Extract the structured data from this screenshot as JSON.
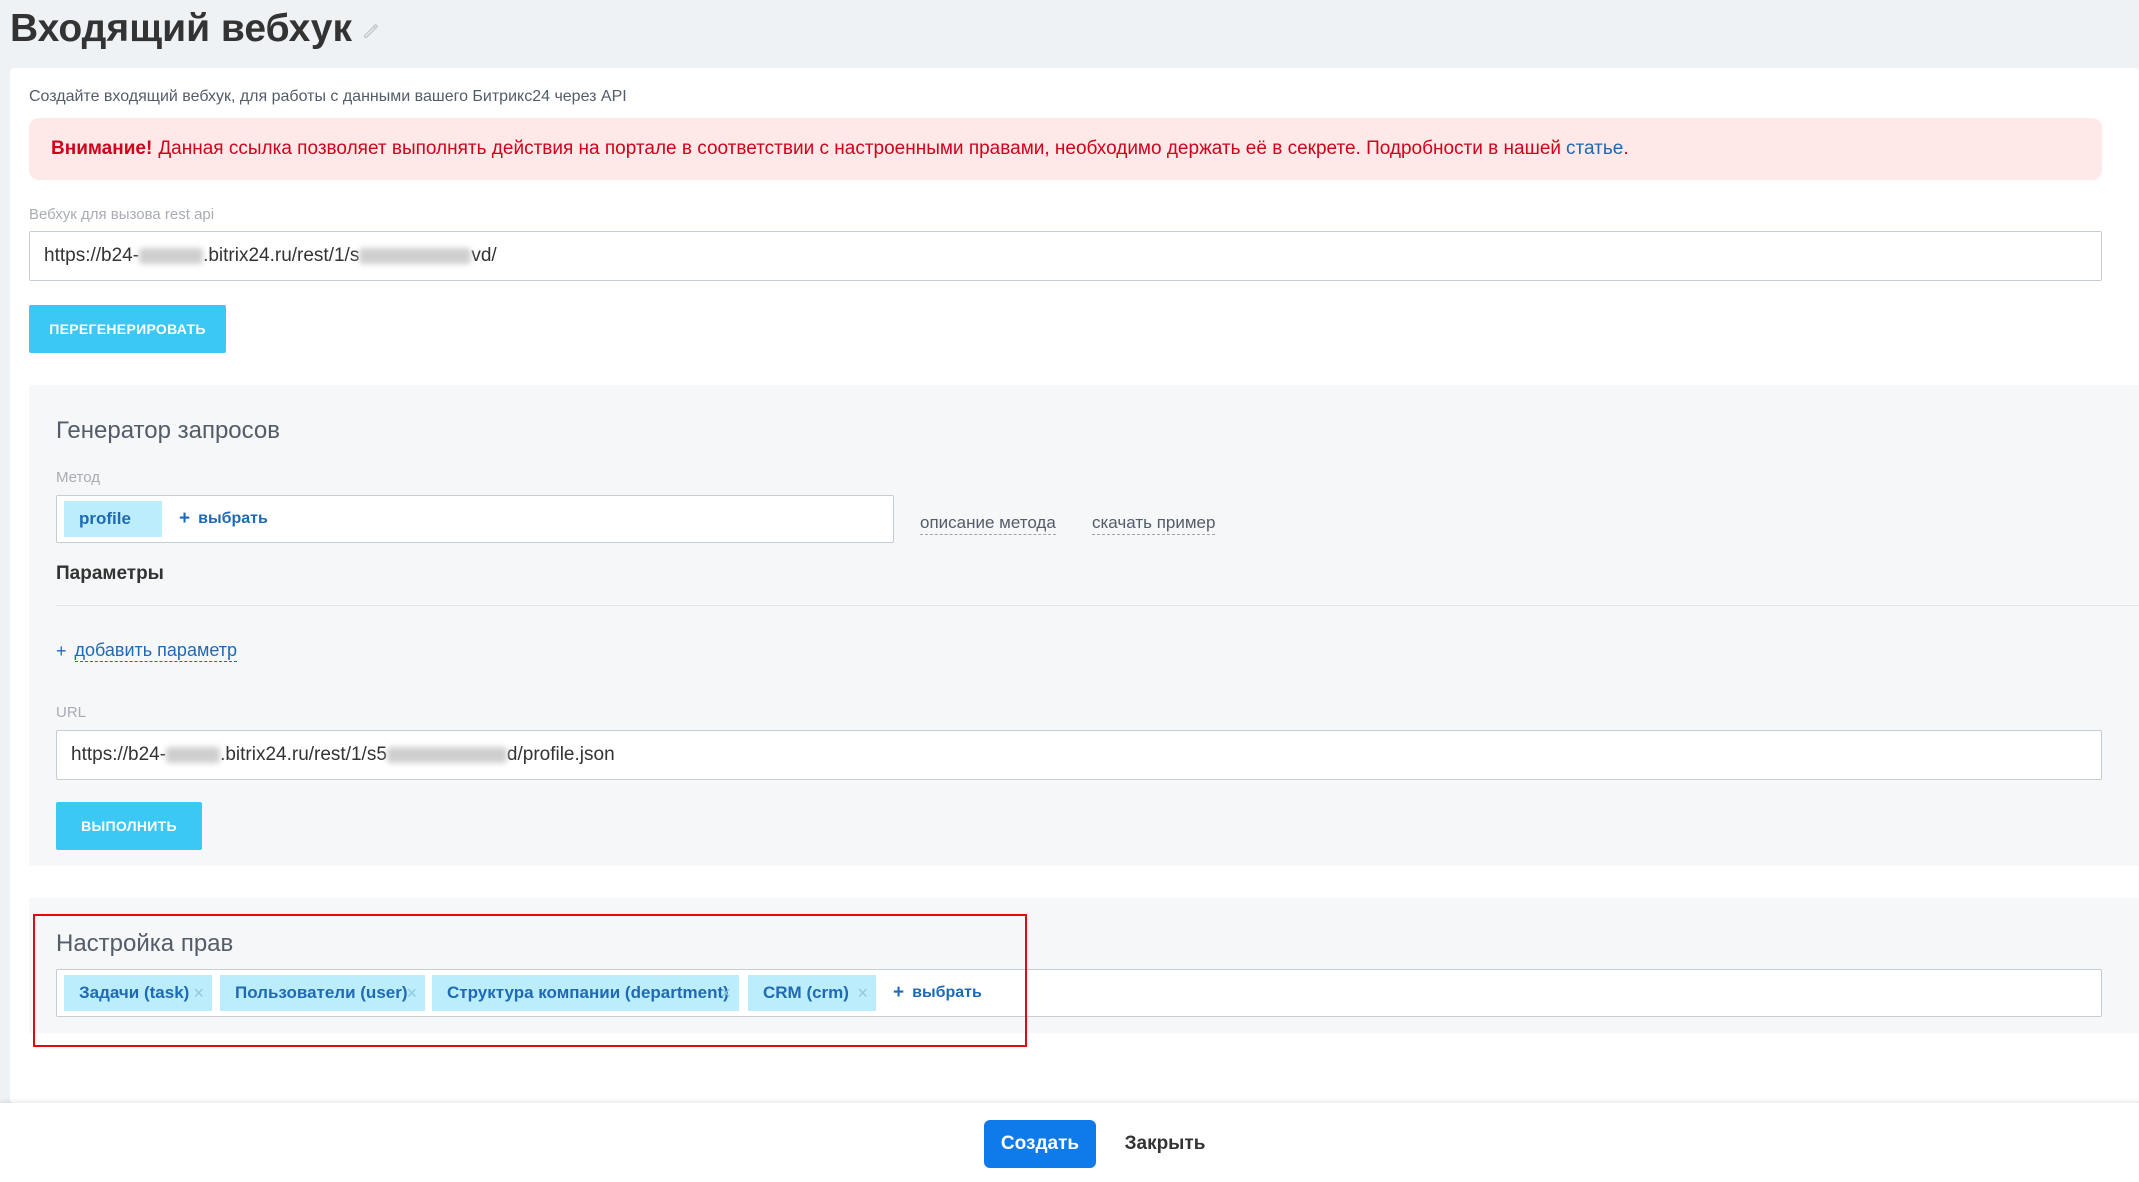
{
  "page": {
    "title": "Входящий вебхук"
  },
  "intro": {
    "subtitle": "Создайте входящий вебхук, для работы с данными вашего Битрикс24 через API"
  },
  "alert": {
    "strong": "Внимание!",
    "text": "Данная ссылка позволяет выполнять действия на портале в соответствии с настроенными правами, необходимо держать её в секрете. Подробности в нашей",
    "link": "статье",
    "trail": "."
  },
  "webhook": {
    "label": "Вебхук для вызова rest api",
    "url_prefix": "https://b24-",
    "url_mid": ".bitrix24.ru/rest/1/s",
    "url_suffix": "vd/",
    "regenerate_label": "ПЕРЕГЕНЕРИРОВАТЬ"
  },
  "generator": {
    "title": "Генератор запросов",
    "method_label": "Метод",
    "method_value": "profile",
    "choose_label": "выбрать",
    "method_description": "описание метода",
    "download_example": "скачать пример",
    "params_label": "Параметры",
    "add_param": "добавить параметр",
    "url_label": "URL",
    "url_prefix": "https://b24-",
    "url_mid": ".bitrix24.ru/rest/1/s5",
    "url_suffix": "d/profile.json",
    "execute_label": "ВЫПОЛНИТЬ"
  },
  "permissions": {
    "title": "Настройка прав",
    "chips": [
      {
        "label": "Задачи (task)"
      },
      {
        "label": "Пользователи (user)"
      },
      {
        "label": "Структура компании (department)"
      },
      {
        "label": "CRM (crm)"
      }
    ],
    "choose_label": "выбрать",
    "remove_symbol": "×",
    "plus_symbol": "+"
  },
  "footer": {
    "create_label": "Создать",
    "close_label": "Закрыть"
  },
  "colors": {
    "accent": "#3bc8f5",
    "primary": "#0f7ae9",
    "alert_bg": "#ffe8e8",
    "alert_text": "#d0021b",
    "highlight": "#e20a0a"
  }
}
